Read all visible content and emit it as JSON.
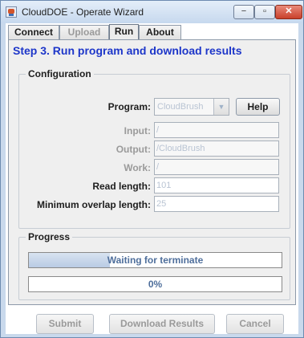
{
  "window": {
    "title": "CloudDOE - Operate Wizard",
    "controls": {
      "minimize": "−",
      "maximize": "▫",
      "close": "✕"
    }
  },
  "tabs": [
    {
      "label": "Connect",
      "state": "normal"
    },
    {
      "label": "Upload",
      "state": "disabled"
    },
    {
      "label": "Run",
      "state": "active"
    },
    {
      "label": "About",
      "state": "normal"
    }
  ],
  "step_title": "Step 3. Run program and download results",
  "configuration": {
    "title": "Configuration",
    "program": {
      "label": "Program:",
      "value": "CloudBrush",
      "arrow_icon": "▼"
    },
    "help_label": "Help",
    "input": {
      "label": "Input:",
      "value": "/"
    },
    "output": {
      "label": "Output:",
      "value": "/CloudBrush"
    },
    "work": {
      "label": "Work:",
      "value": "/"
    },
    "read_length": {
      "label": "Read length:",
      "value": "101"
    },
    "min_overlap": {
      "label": "Minimum overlap length:",
      "value": "25"
    }
  },
  "progress": {
    "title": "Progress",
    "status_text": "Waiting for terminate",
    "status_fill_fraction": 0.32,
    "percent_text": "0%",
    "percent_fraction": 0
  },
  "buttons": {
    "submit": "Submit",
    "download": "Download Results",
    "cancel": "Cancel"
  },
  "colors": {
    "step_title": "#1d36c9",
    "disabled_text": "#9a9a9a",
    "field_value_text": "#b9c4d3",
    "progress_fill": "#b9cbe4",
    "progress_text": "#4f6f9c"
  }
}
